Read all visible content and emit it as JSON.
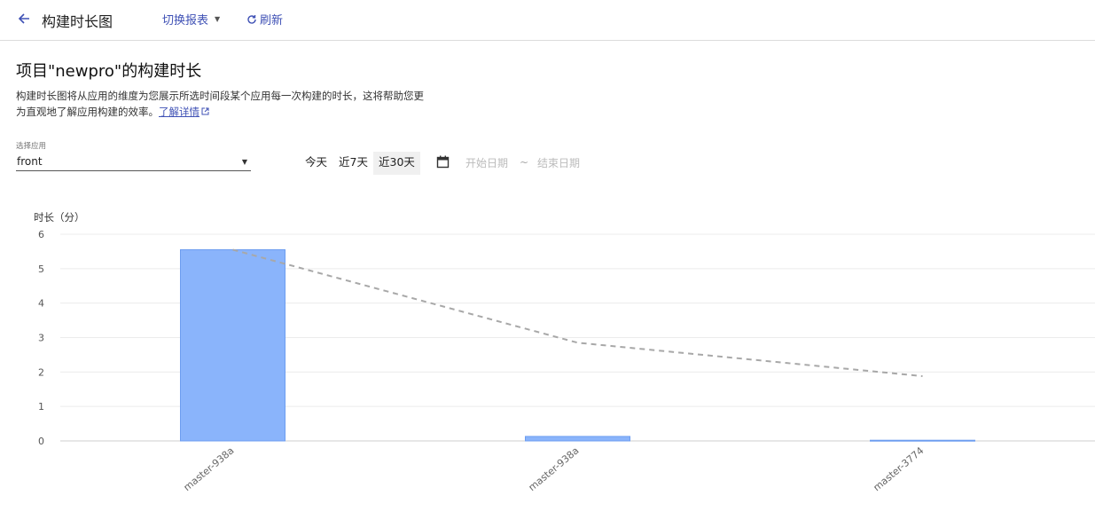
{
  "header": {
    "back_icon": "arrow-left-icon",
    "title": "构建时长图",
    "switch_report": "切换报表",
    "refresh": "刷新"
  },
  "main": {
    "heading": "项目\"newpro\"的构建时长",
    "description": "构建时长图将从应用的维度为您展示所选时间段某个应用每一次构建的时长，这将帮助您更为直观地了解应用构建的效率。",
    "learn_more": "了解详情"
  },
  "filters": {
    "select_label": "选择应用",
    "selected_app": "front",
    "ranges": [
      "今天",
      "近7天",
      "近30天"
    ],
    "active_range": "近30天",
    "start_placeholder": "开始日期",
    "tilde": "~",
    "end_placeholder": "结束日期"
  },
  "colors": {
    "accent": "#3f51b5",
    "bar": "#8ab4fb",
    "bar_border": "#6d9df0",
    "line": "#a8a8a8"
  },
  "chart_data": {
    "type": "bar",
    "ylabel": "时长（分）",
    "categories": [
      "master-938a",
      "master-938a",
      "master-3774"
    ],
    "series": [
      {
        "type": "bar",
        "values": [
          5.55,
          0.13,
          0.02
        ]
      },
      {
        "type": "line",
        "style": "dashed",
        "values": [
          5.55,
          2.85,
          1.88
        ]
      }
    ],
    "ylim": [
      0,
      6
    ],
    "yticks": [
      0,
      1,
      2,
      3,
      4,
      5,
      6
    ],
    "grid": true
  }
}
